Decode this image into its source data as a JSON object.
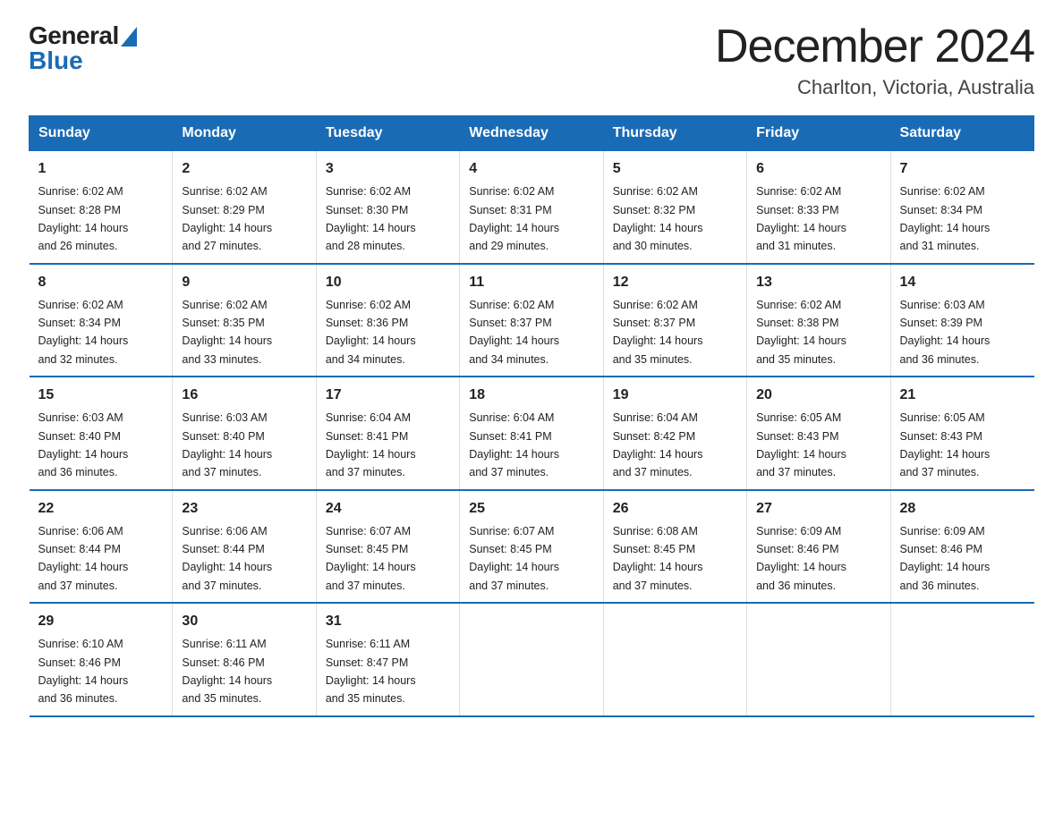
{
  "logo": {
    "general": "General",
    "blue": "Blue"
  },
  "title": "December 2024",
  "subtitle": "Charlton, Victoria, Australia",
  "headers": [
    "Sunday",
    "Monday",
    "Tuesday",
    "Wednesday",
    "Thursday",
    "Friday",
    "Saturday"
  ],
  "weeks": [
    [
      {
        "day": "1",
        "sunrise": "6:02 AM",
        "sunset": "8:28 PM",
        "daylight": "14 hours and 26 minutes."
      },
      {
        "day": "2",
        "sunrise": "6:02 AM",
        "sunset": "8:29 PM",
        "daylight": "14 hours and 27 minutes."
      },
      {
        "day": "3",
        "sunrise": "6:02 AM",
        "sunset": "8:30 PM",
        "daylight": "14 hours and 28 minutes."
      },
      {
        "day": "4",
        "sunrise": "6:02 AM",
        "sunset": "8:31 PM",
        "daylight": "14 hours and 29 minutes."
      },
      {
        "day": "5",
        "sunrise": "6:02 AM",
        "sunset": "8:32 PM",
        "daylight": "14 hours and 30 minutes."
      },
      {
        "day": "6",
        "sunrise": "6:02 AM",
        "sunset": "8:33 PM",
        "daylight": "14 hours and 31 minutes."
      },
      {
        "day": "7",
        "sunrise": "6:02 AM",
        "sunset": "8:34 PM",
        "daylight": "14 hours and 31 minutes."
      }
    ],
    [
      {
        "day": "8",
        "sunrise": "6:02 AM",
        "sunset": "8:34 PM",
        "daylight": "14 hours and 32 minutes."
      },
      {
        "day": "9",
        "sunrise": "6:02 AM",
        "sunset": "8:35 PM",
        "daylight": "14 hours and 33 minutes."
      },
      {
        "day": "10",
        "sunrise": "6:02 AM",
        "sunset": "8:36 PM",
        "daylight": "14 hours and 34 minutes."
      },
      {
        "day": "11",
        "sunrise": "6:02 AM",
        "sunset": "8:37 PM",
        "daylight": "14 hours and 34 minutes."
      },
      {
        "day": "12",
        "sunrise": "6:02 AM",
        "sunset": "8:37 PM",
        "daylight": "14 hours and 35 minutes."
      },
      {
        "day": "13",
        "sunrise": "6:02 AM",
        "sunset": "8:38 PM",
        "daylight": "14 hours and 35 minutes."
      },
      {
        "day": "14",
        "sunrise": "6:03 AM",
        "sunset": "8:39 PM",
        "daylight": "14 hours and 36 minutes."
      }
    ],
    [
      {
        "day": "15",
        "sunrise": "6:03 AM",
        "sunset": "8:40 PM",
        "daylight": "14 hours and 36 minutes."
      },
      {
        "day": "16",
        "sunrise": "6:03 AM",
        "sunset": "8:40 PM",
        "daylight": "14 hours and 37 minutes."
      },
      {
        "day": "17",
        "sunrise": "6:04 AM",
        "sunset": "8:41 PM",
        "daylight": "14 hours and 37 minutes."
      },
      {
        "day": "18",
        "sunrise": "6:04 AM",
        "sunset": "8:41 PM",
        "daylight": "14 hours and 37 minutes."
      },
      {
        "day": "19",
        "sunrise": "6:04 AM",
        "sunset": "8:42 PM",
        "daylight": "14 hours and 37 minutes."
      },
      {
        "day": "20",
        "sunrise": "6:05 AM",
        "sunset": "8:43 PM",
        "daylight": "14 hours and 37 minutes."
      },
      {
        "day": "21",
        "sunrise": "6:05 AM",
        "sunset": "8:43 PM",
        "daylight": "14 hours and 37 minutes."
      }
    ],
    [
      {
        "day": "22",
        "sunrise": "6:06 AM",
        "sunset": "8:44 PM",
        "daylight": "14 hours and 37 minutes."
      },
      {
        "day": "23",
        "sunrise": "6:06 AM",
        "sunset": "8:44 PM",
        "daylight": "14 hours and 37 minutes."
      },
      {
        "day": "24",
        "sunrise": "6:07 AM",
        "sunset": "8:45 PM",
        "daylight": "14 hours and 37 minutes."
      },
      {
        "day": "25",
        "sunrise": "6:07 AM",
        "sunset": "8:45 PM",
        "daylight": "14 hours and 37 minutes."
      },
      {
        "day": "26",
        "sunrise": "6:08 AM",
        "sunset": "8:45 PM",
        "daylight": "14 hours and 37 minutes."
      },
      {
        "day": "27",
        "sunrise": "6:09 AM",
        "sunset": "8:46 PM",
        "daylight": "14 hours and 36 minutes."
      },
      {
        "day": "28",
        "sunrise": "6:09 AM",
        "sunset": "8:46 PM",
        "daylight": "14 hours and 36 minutes."
      }
    ],
    [
      {
        "day": "29",
        "sunrise": "6:10 AM",
        "sunset": "8:46 PM",
        "daylight": "14 hours and 36 minutes."
      },
      {
        "day": "30",
        "sunrise": "6:11 AM",
        "sunset": "8:46 PM",
        "daylight": "14 hours and 35 minutes."
      },
      {
        "day": "31",
        "sunrise": "6:11 AM",
        "sunset": "8:47 PM",
        "daylight": "14 hours and 35 minutes."
      },
      null,
      null,
      null,
      null
    ]
  ],
  "labels": {
    "sunrise": "Sunrise:",
    "sunset": "Sunset:",
    "daylight": "Daylight:"
  }
}
